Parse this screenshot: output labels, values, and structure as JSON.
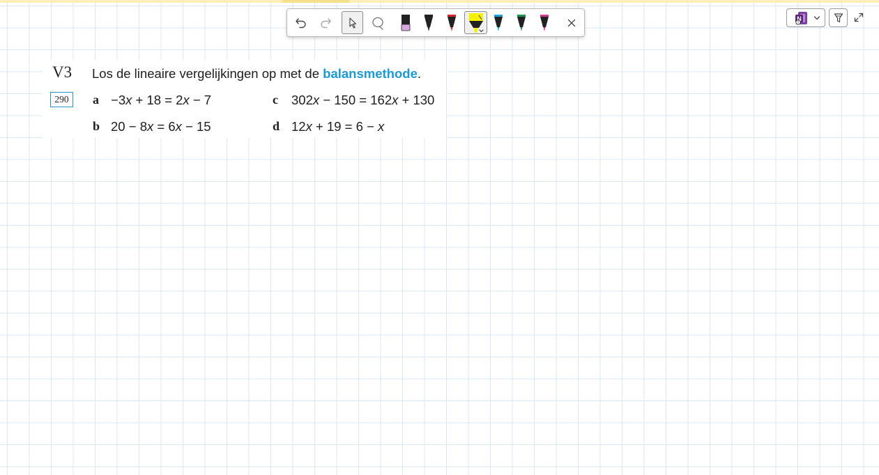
{
  "toolbar": {
    "tools": [
      {
        "name": "undo",
        "icon": "undo-icon"
      },
      {
        "name": "redo",
        "icon": "redo-icon"
      },
      {
        "name": "select",
        "icon": "cursor-icon",
        "selected": true
      },
      {
        "name": "lasso",
        "icon": "lasso-icon"
      },
      {
        "name": "pen",
        "icon": "pen-icon",
        "color": "#d9a8e0"
      },
      {
        "name": "pen",
        "icon": "pen-icon",
        "color": "#222222"
      },
      {
        "name": "pen",
        "icon": "pen-icon",
        "color": "#d8262f"
      },
      {
        "name": "highlighter",
        "icon": "highlighter-icon",
        "color": "#f5f200",
        "selected": true
      },
      {
        "name": "pen",
        "icon": "pen-icon",
        "color": "#1fa6dd"
      },
      {
        "name": "pen",
        "icon": "pen-icon",
        "color": "#1f9a4b"
      },
      {
        "name": "pen",
        "icon": "pen-icon",
        "color": "#d63a9c"
      },
      {
        "name": "close",
        "icon": "close-icon"
      }
    ]
  },
  "controls": {
    "app_icon": "onenote-icon",
    "dropdown_icon": "chevron-down-icon",
    "filter_icon": "funnel-icon",
    "expand_icon": "expand-icon"
  },
  "exercise": {
    "number": "V3",
    "instruction_before": "Los de lineaire vergelijkingen op met de ",
    "instruction_keyword": "balansmethode",
    "instruction_after": ".",
    "page_ref": "290",
    "keyword_color": "#1a9bd7",
    "questions": [
      {
        "letter": "a",
        "equation": "−3x + 18 = 2x − 7"
      },
      {
        "letter": "b",
        "equation": "20 − 8x = 6x − 15"
      },
      {
        "letter": "c",
        "equation": "302x − 150 = 162x + 130"
      },
      {
        "letter": "d",
        "equation": "12x + 19 = 6 − x"
      }
    ]
  }
}
